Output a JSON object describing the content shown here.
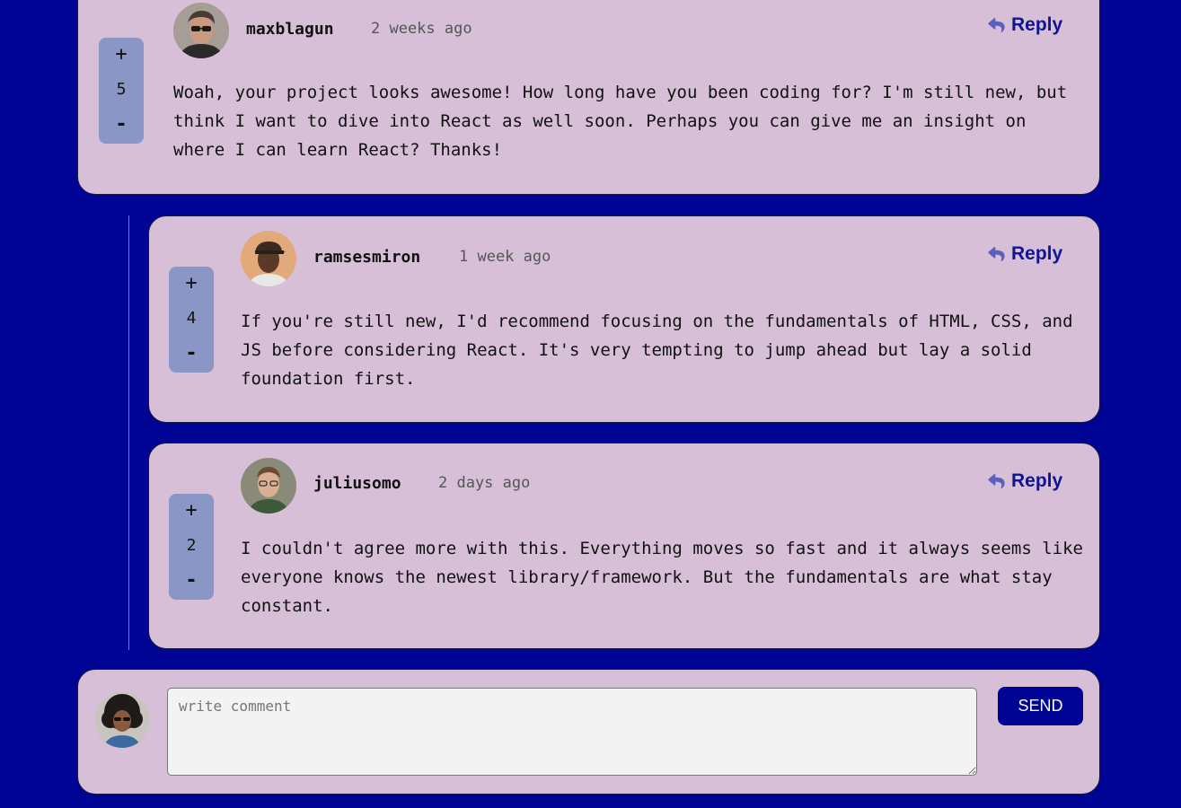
{
  "colors": {
    "page_background": "#000494",
    "card_background": "#d7bfd7",
    "vote_background": "#8a96c6",
    "accent": "#101490",
    "reply_icon": "#5a5fc2"
  },
  "comments": [
    {
      "vote": {
        "plus_label": "+",
        "score": "5",
        "minus_label": "-"
      },
      "username": "maxblagun",
      "timestamp": "2 weeks ago",
      "reply_label": "Reply",
      "text": "Woah, your project looks awesome! How long have you been coding for? I'm still new, but think I want to dive into React as well soon. Perhaps you can give me an insight on where I can learn React? Thanks!"
    }
  ],
  "replies": [
    {
      "vote": {
        "plus_label": "+",
        "score": "4",
        "minus_label": "-"
      },
      "username": "ramsesmiron",
      "timestamp": "1 week ago",
      "reply_label": "Reply",
      "text": "If you're still new, I'd recommend focusing on the fundamentals of HTML, CSS, and JS before considering React. It's very tempting to jump ahead but lay a solid foundation first."
    },
    {
      "vote": {
        "plus_label": "+",
        "score": "2",
        "minus_label": "-"
      },
      "username": "juliusomo",
      "timestamp": "2 days ago",
      "reply_label": "Reply",
      "text": "I couldn't agree more with this. Everything moves so fast and it always seems like everyone knows the newest library/framework. But the fundamentals are what stay constant."
    }
  ],
  "composer": {
    "placeholder": "write comment",
    "value": "",
    "send_label": "SEND"
  },
  "icons": {
    "reply": "reply-arrow-icon",
    "avatar": "user-avatar"
  }
}
